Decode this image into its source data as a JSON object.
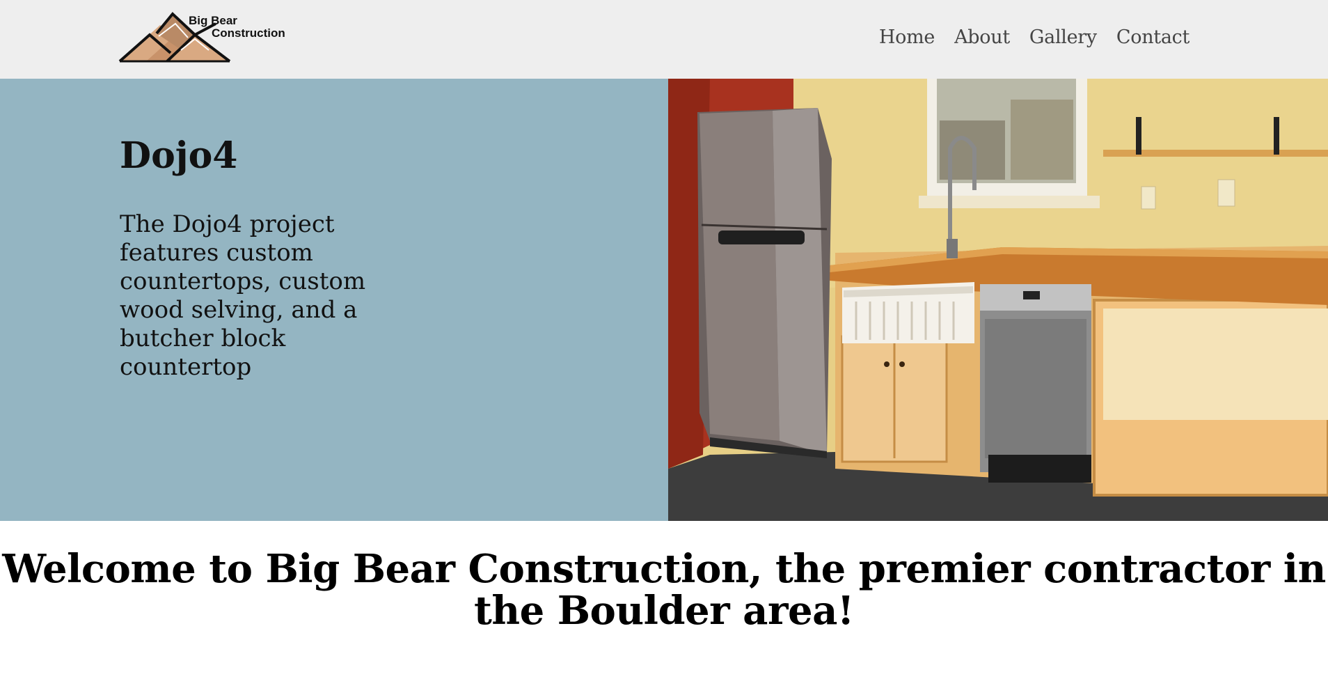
{
  "header": {
    "logo": {
      "line1": "Big Bear",
      "line2": "Construction",
      "icon": "mountain-logo-icon"
    },
    "nav": [
      {
        "label": "Home"
      },
      {
        "label": "About"
      },
      {
        "label": "Gallery"
      },
      {
        "label": "Contact"
      }
    ]
  },
  "hero": {
    "title": "Dojo4",
    "description": "The Dojo4 project features custom countertops, custom wood selving, and a butcher block countertop",
    "background_color": "#94b5c2",
    "image_subject": "kitchen-photo"
  },
  "welcome": {
    "text": "Welcome to Big Bear Construction, the premier contractor in the Boulder area!"
  }
}
